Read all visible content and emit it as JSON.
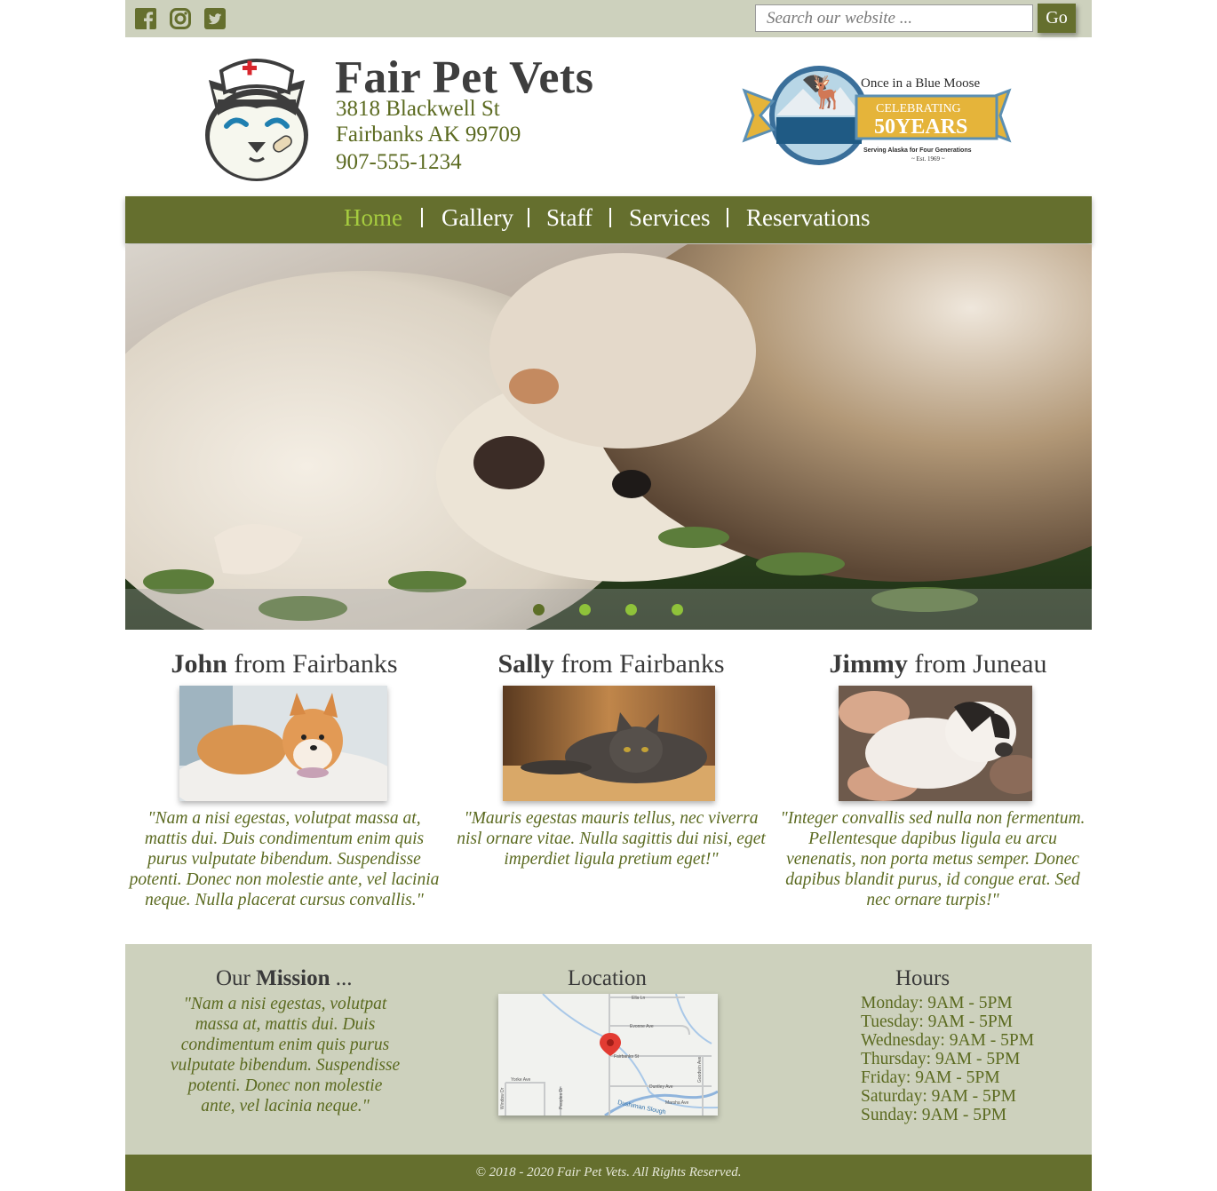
{
  "topbar": {
    "social": [
      "facebook-icon",
      "instagram-icon",
      "twitter-icon"
    ],
    "search_placeholder": "Search our website ...",
    "go_label": "Go"
  },
  "header": {
    "title": "Fair Pet Vets",
    "address_line1": "3818 Blackwell St",
    "address_line2": "Fairbanks AK 99709",
    "phone": "907-555-1234",
    "badge": {
      "line1": "Once in a Blue Moose",
      "line2": "CELEBRATING",
      "line3": "50YEARS",
      "line4": "Serving Alaska for Four Generations",
      "line5": "~ Est. 1969 ~"
    }
  },
  "nav": {
    "items": [
      "Home",
      "Gallery",
      "Staff",
      "Services",
      "Reservations"
    ],
    "active": "Home"
  },
  "carousel": {
    "slides": 4,
    "active_index": 0
  },
  "testimonials": [
    {
      "name": "John",
      "place": "from Fairbanks",
      "quote": "\"Nam a nisi egestas, volutpat massa at, mattis dui. Duis condimentum enim quis purus vulputate bibendum. Suspendisse potenti. Donec non molestie ante, vel lacinia neque. Nulla placerat cursus convallis.\""
    },
    {
      "name": "Sally",
      "place": "from Fairbanks",
      "quote": "\"Mauris egestas mauris tellus, nec viverra nisl ornare vitae. Nulla sagittis dui nisi, eget imperdiet ligula pretium eget!\""
    },
    {
      "name": "Jimmy",
      "place": "from Juneau",
      "quote": "\"Integer convallis sed nulla non fermentum. Pellentesque dapibus ligula eu arcu venenatis, non porta metus semper. Donec dapibus blandit purus, id congue erat. Sed nec ornare turpis!\""
    }
  ],
  "mission": {
    "heading_prefix": "Our",
    "heading_bold": "Mission",
    "heading_suffix": "...",
    "text": "\"Nam a nisi egestas, volutpat massa at, mattis dui. Duis condimentum enim quis purus vulputate bibendum. Suspendisse potenti. Donec non molestie ante, vel lacinia neque.\""
  },
  "location": {
    "heading": "Location",
    "streets": [
      "Ella Ln",
      "Evonne Ave",
      "Fairbanks St",
      "Yorke Ave",
      "Duntley Ave",
      "Marsha Ave",
      "Dushiman Slough",
      "Window Dr",
      "Peoples Dr",
      "Goodwin Ave"
    ]
  },
  "hours": {
    "heading": "Hours",
    "days": [
      "Monday: 9AM - 5PM",
      "Tuesday: 9AM - 5PM",
      "Wednesday: 9AM - 5PM",
      "Thursday: 9AM - 5PM",
      "Friday: 9AM - 5PM",
      "Saturday: 9AM - 5PM",
      "Sunday: 9AM - 5PM"
    ]
  },
  "footer": {
    "copyright": "© 2018 - 2020 Fair Pet Vets. All Rights Reserved."
  },
  "colors": {
    "olive": "#656f2e",
    "sage": "#cdd1bd",
    "active_nav": "#a6cc3f",
    "text_green": "#5b6a20"
  }
}
